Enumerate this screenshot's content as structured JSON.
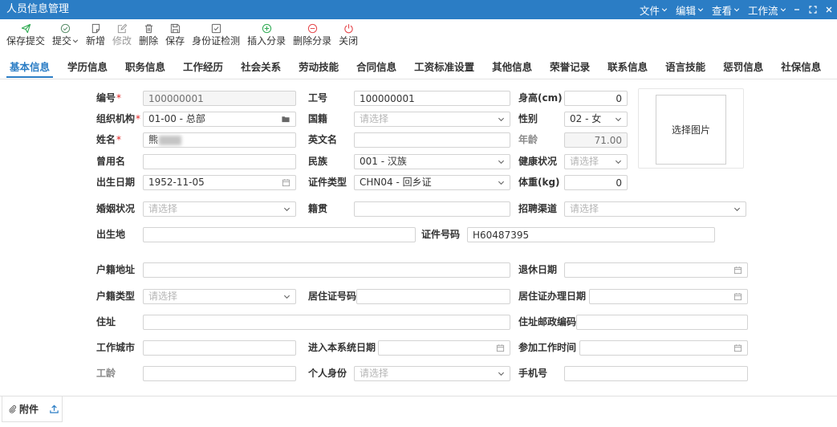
{
  "app": {
    "title": "人员信息管理"
  },
  "menubar": [
    {
      "label": "文件",
      "icon": "chevron-down-icon"
    },
    {
      "label": "编辑",
      "icon": "chevron-down-icon"
    },
    {
      "label": "查看",
      "icon": "chevron-down-icon"
    },
    {
      "label": "工作流",
      "icon": "chevron-down-icon"
    }
  ],
  "window_controls": [
    {
      "icon": "minimize-icon"
    },
    {
      "icon": "maximize-icon"
    },
    {
      "icon": "close-icon"
    }
  ],
  "toolbar": {
    "items": [
      {
        "label": "保存提交",
        "icon": "send-icon"
      },
      {
        "label": "提交",
        "icon": "check-circle-icon",
        "has_dropdown": true
      },
      {
        "label": "新增",
        "icon": "new-document-icon"
      },
      {
        "label": "修改",
        "icon": "edit-icon",
        "disabled": true
      },
      {
        "label": "删除",
        "icon": "trash-icon"
      },
      {
        "label": "保存",
        "icon": "save-icon"
      },
      {
        "label": "身份证检测",
        "icon": "id-check-icon"
      },
      {
        "label": "插入分录",
        "icon": "plus-circle-icon"
      },
      {
        "label": "删除分录",
        "icon": "minus-circle-icon"
      },
      {
        "label": "关闭",
        "icon": "power-icon"
      }
    ]
  },
  "tabs": [
    {
      "label": "基本信息",
      "active": true
    },
    {
      "label": "学历信息"
    },
    {
      "label": "职务信息"
    },
    {
      "label": "工作经历"
    },
    {
      "label": "社会关系"
    },
    {
      "label": "劳动技能"
    },
    {
      "label": "合同信息"
    },
    {
      "label": "工资标准设置"
    },
    {
      "label": "其他信息"
    },
    {
      "label": "荣誉记录"
    },
    {
      "label": "联系信息"
    },
    {
      "label": "语言技能"
    },
    {
      "label": "惩罚信息"
    },
    {
      "label": "社保信息"
    }
  ],
  "form": {
    "employee_no": {
      "label": "编号",
      "required_mark": "*",
      "value": "100000001"
    },
    "job_no": {
      "label": "工号",
      "value": "100000001"
    },
    "height_cm": {
      "label": "身高(cm)",
      "value": "0"
    },
    "organization": {
      "label": "组织机构",
      "required_mark": "*",
      "value": "01-00 - 总部"
    },
    "nationality": {
      "label": "国籍",
      "placeholder": "请选择"
    },
    "gender": {
      "label": "性别",
      "value": "02 - 女"
    },
    "name": {
      "label": "姓名",
      "required_mark": "*",
      "value": "熊"
    },
    "english_name": {
      "label": "英文名",
      "value": ""
    },
    "age": {
      "label": "年龄",
      "value": "71.00"
    },
    "former_name": {
      "label": "曾用名",
      "value": ""
    },
    "ethnicity": {
      "label": "民族",
      "value": "001 - 汉族"
    },
    "health_status": {
      "label": "健康状况",
      "placeholder": "请选择"
    },
    "birth_date": {
      "label": "出生日期",
      "value": "1952-11-05"
    },
    "id_type": {
      "label": "证件类型",
      "value": "CHN04 - 回乡证"
    },
    "weight_kg": {
      "label": "体重(kg)",
      "value": "0"
    },
    "marital_status": {
      "label": "婚姻状况",
      "placeholder": "请选择"
    },
    "native_place": {
      "label": "籍贯",
      "value": ""
    },
    "recruit_channel": {
      "label": "招聘渠道",
      "placeholder": "请选择"
    },
    "birth_place": {
      "label": "出生地",
      "value": ""
    },
    "id_number": {
      "label": "证件号码",
      "value": "H60487395"
    },
    "household_address": {
      "label": "户籍地址",
      "value": ""
    },
    "retire_date": {
      "label": "退休日期",
      "value": ""
    },
    "household_type": {
      "label": "户籍类型",
      "placeholder": "请选择"
    },
    "residence_permit_no": {
      "label": "居住证号码",
      "value": ""
    },
    "residence_permit_date": {
      "label": "居住证办理日期",
      "value": ""
    },
    "address": {
      "label": "住址",
      "value": ""
    },
    "address_postcode": {
      "label": "住址邮政编码",
      "value": ""
    },
    "work_city": {
      "label": "工作城市",
      "value": ""
    },
    "system_entry_date": {
      "label": "进入本系统日期",
      "value": ""
    },
    "work_start_date": {
      "label": "参加工作时间",
      "value": ""
    },
    "work_years": {
      "label": "工龄",
      "value": ""
    },
    "personal_identity": {
      "label": "个人身份",
      "placeholder": "请选择"
    },
    "mobile": {
      "label": "手机号",
      "value": ""
    }
  },
  "photo": {
    "button_label": "选择图片"
  },
  "attachments": {
    "label": "附件",
    "icon": "paperclip-icon",
    "upload_icon": "upload-icon"
  },
  "colors": {
    "titlebar": "#2b7dc5",
    "accent": "#2b7dc5",
    "required": "#e02020",
    "green_icon": "#2eaa52",
    "red_icon": "#e5484d"
  }
}
